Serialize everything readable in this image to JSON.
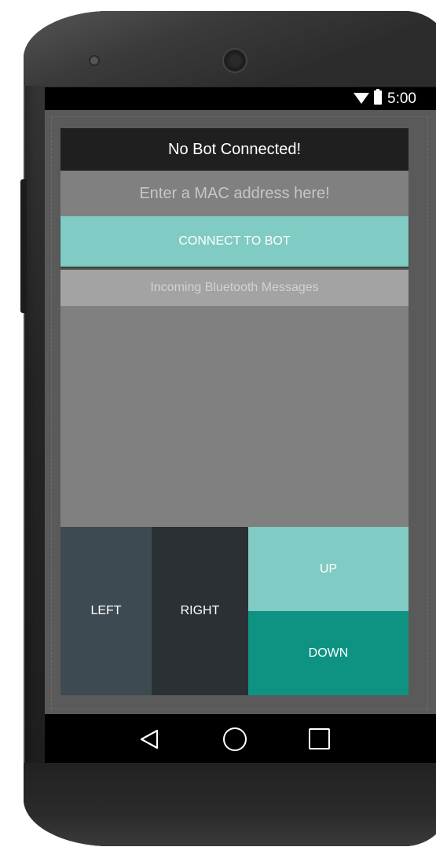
{
  "status_bar": {
    "time": "5:00",
    "icons": [
      "wifi-icon",
      "battery-icon"
    ]
  },
  "header": {
    "title": "No Bot Connected!"
  },
  "mac_input": {
    "value": "",
    "placeholder": "Enter a MAC address here!"
  },
  "connect_button": {
    "label": "CONNECT TO BOT"
  },
  "incoming": {
    "label": "Incoming Bluetooth Messages",
    "messages": []
  },
  "controls": {
    "left_label": "LEFT",
    "right_label": "RIGHT",
    "up_label": "UP",
    "down_label": "DOWN"
  },
  "nav_bar": {
    "icons": [
      "back-icon",
      "home-icon",
      "recents-icon"
    ]
  },
  "colors": {
    "accent_light": "#80cbc4",
    "accent_dark": "#0e9383",
    "left_button": "#3e4a52",
    "right_button": "#2b3035",
    "title_bar": "#1f1f1f",
    "content_gray": "#808080"
  }
}
